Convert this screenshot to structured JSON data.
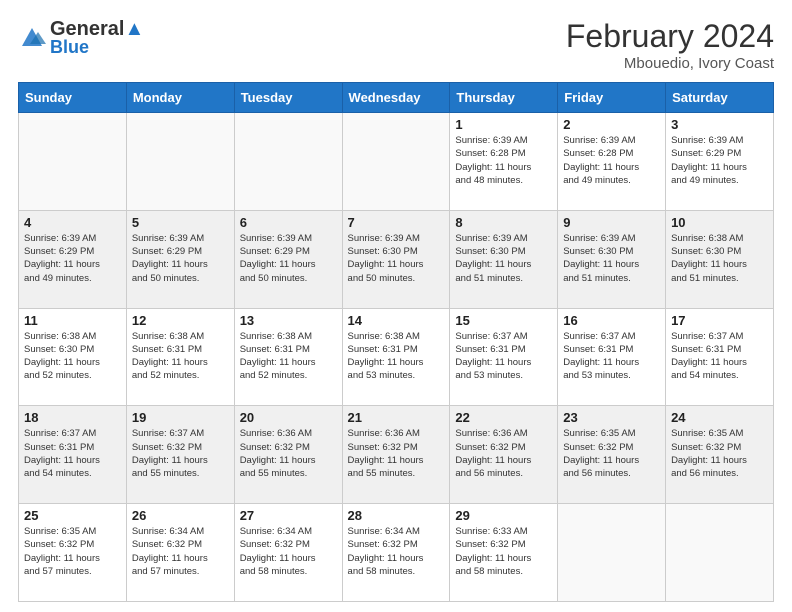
{
  "header": {
    "logo_line1": "General",
    "logo_line2": "Blue",
    "month_year": "February 2024",
    "location": "Mbouedio, Ivory Coast"
  },
  "days_of_week": [
    "Sunday",
    "Monday",
    "Tuesday",
    "Wednesday",
    "Thursday",
    "Friday",
    "Saturday"
  ],
  "weeks": [
    [
      {
        "day": "",
        "info": ""
      },
      {
        "day": "",
        "info": ""
      },
      {
        "day": "",
        "info": ""
      },
      {
        "day": "",
        "info": ""
      },
      {
        "day": "1",
        "info": "Sunrise: 6:39 AM\nSunset: 6:28 PM\nDaylight: 11 hours\nand 48 minutes."
      },
      {
        "day": "2",
        "info": "Sunrise: 6:39 AM\nSunset: 6:28 PM\nDaylight: 11 hours\nand 49 minutes."
      },
      {
        "day": "3",
        "info": "Sunrise: 6:39 AM\nSunset: 6:29 PM\nDaylight: 11 hours\nand 49 minutes."
      }
    ],
    [
      {
        "day": "4",
        "info": "Sunrise: 6:39 AM\nSunset: 6:29 PM\nDaylight: 11 hours\nand 49 minutes."
      },
      {
        "day": "5",
        "info": "Sunrise: 6:39 AM\nSunset: 6:29 PM\nDaylight: 11 hours\nand 50 minutes."
      },
      {
        "day": "6",
        "info": "Sunrise: 6:39 AM\nSunset: 6:29 PM\nDaylight: 11 hours\nand 50 minutes."
      },
      {
        "day": "7",
        "info": "Sunrise: 6:39 AM\nSunset: 6:30 PM\nDaylight: 11 hours\nand 50 minutes."
      },
      {
        "day": "8",
        "info": "Sunrise: 6:39 AM\nSunset: 6:30 PM\nDaylight: 11 hours\nand 51 minutes."
      },
      {
        "day": "9",
        "info": "Sunrise: 6:39 AM\nSunset: 6:30 PM\nDaylight: 11 hours\nand 51 minutes."
      },
      {
        "day": "10",
        "info": "Sunrise: 6:38 AM\nSunset: 6:30 PM\nDaylight: 11 hours\nand 51 minutes."
      }
    ],
    [
      {
        "day": "11",
        "info": "Sunrise: 6:38 AM\nSunset: 6:30 PM\nDaylight: 11 hours\nand 52 minutes."
      },
      {
        "day": "12",
        "info": "Sunrise: 6:38 AM\nSunset: 6:31 PM\nDaylight: 11 hours\nand 52 minutes."
      },
      {
        "day": "13",
        "info": "Sunrise: 6:38 AM\nSunset: 6:31 PM\nDaylight: 11 hours\nand 52 minutes."
      },
      {
        "day": "14",
        "info": "Sunrise: 6:38 AM\nSunset: 6:31 PM\nDaylight: 11 hours\nand 53 minutes."
      },
      {
        "day": "15",
        "info": "Sunrise: 6:37 AM\nSunset: 6:31 PM\nDaylight: 11 hours\nand 53 minutes."
      },
      {
        "day": "16",
        "info": "Sunrise: 6:37 AM\nSunset: 6:31 PM\nDaylight: 11 hours\nand 53 minutes."
      },
      {
        "day": "17",
        "info": "Sunrise: 6:37 AM\nSunset: 6:31 PM\nDaylight: 11 hours\nand 54 minutes."
      }
    ],
    [
      {
        "day": "18",
        "info": "Sunrise: 6:37 AM\nSunset: 6:31 PM\nDaylight: 11 hours\nand 54 minutes."
      },
      {
        "day": "19",
        "info": "Sunrise: 6:37 AM\nSunset: 6:32 PM\nDaylight: 11 hours\nand 55 minutes."
      },
      {
        "day": "20",
        "info": "Sunrise: 6:36 AM\nSunset: 6:32 PM\nDaylight: 11 hours\nand 55 minutes."
      },
      {
        "day": "21",
        "info": "Sunrise: 6:36 AM\nSunset: 6:32 PM\nDaylight: 11 hours\nand 55 minutes."
      },
      {
        "day": "22",
        "info": "Sunrise: 6:36 AM\nSunset: 6:32 PM\nDaylight: 11 hours\nand 56 minutes."
      },
      {
        "day": "23",
        "info": "Sunrise: 6:35 AM\nSunset: 6:32 PM\nDaylight: 11 hours\nand 56 minutes."
      },
      {
        "day": "24",
        "info": "Sunrise: 6:35 AM\nSunset: 6:32 PM\nDaylight: 11 hours\nand 56 minutes."
      }
    ],
    [
      {
        "day": "25",
        "info": "Sunrise: 6:35 AM\nSunset: 6:32 PM\nDaylight: 11 hours\nand 57 minutes."
      },
      {
        "day": "26",
        "info": "Sunrise: 6:34 AM\nSunset: 6:32 PM\nDaylight: 11 hours\nand 57 minutes."
      },
      {
        "day": "27",
        "info": "Sunrise: 6:34 AM\nSunset: 6:32 PM\nDaylight: 11 hours\nand 58 minutes."
      },
      {
        "day": "28",
        "info": "Sunrise: 6:34 AM\nSunset: 6:32 PM\nDaylight: 11 hours\nand 58 minutes."
      },
      {
        "day": "29",
        "info": "Sunrise: 6:33 AM\nSunset: 6:32 PM\nDaylight: 11 hours\nand 58 minutes."
      },
      {
        "day": "",
        "info": ""
      },
      {
        "day": "",
        "info": ""
      }
    ]
  ]
}
